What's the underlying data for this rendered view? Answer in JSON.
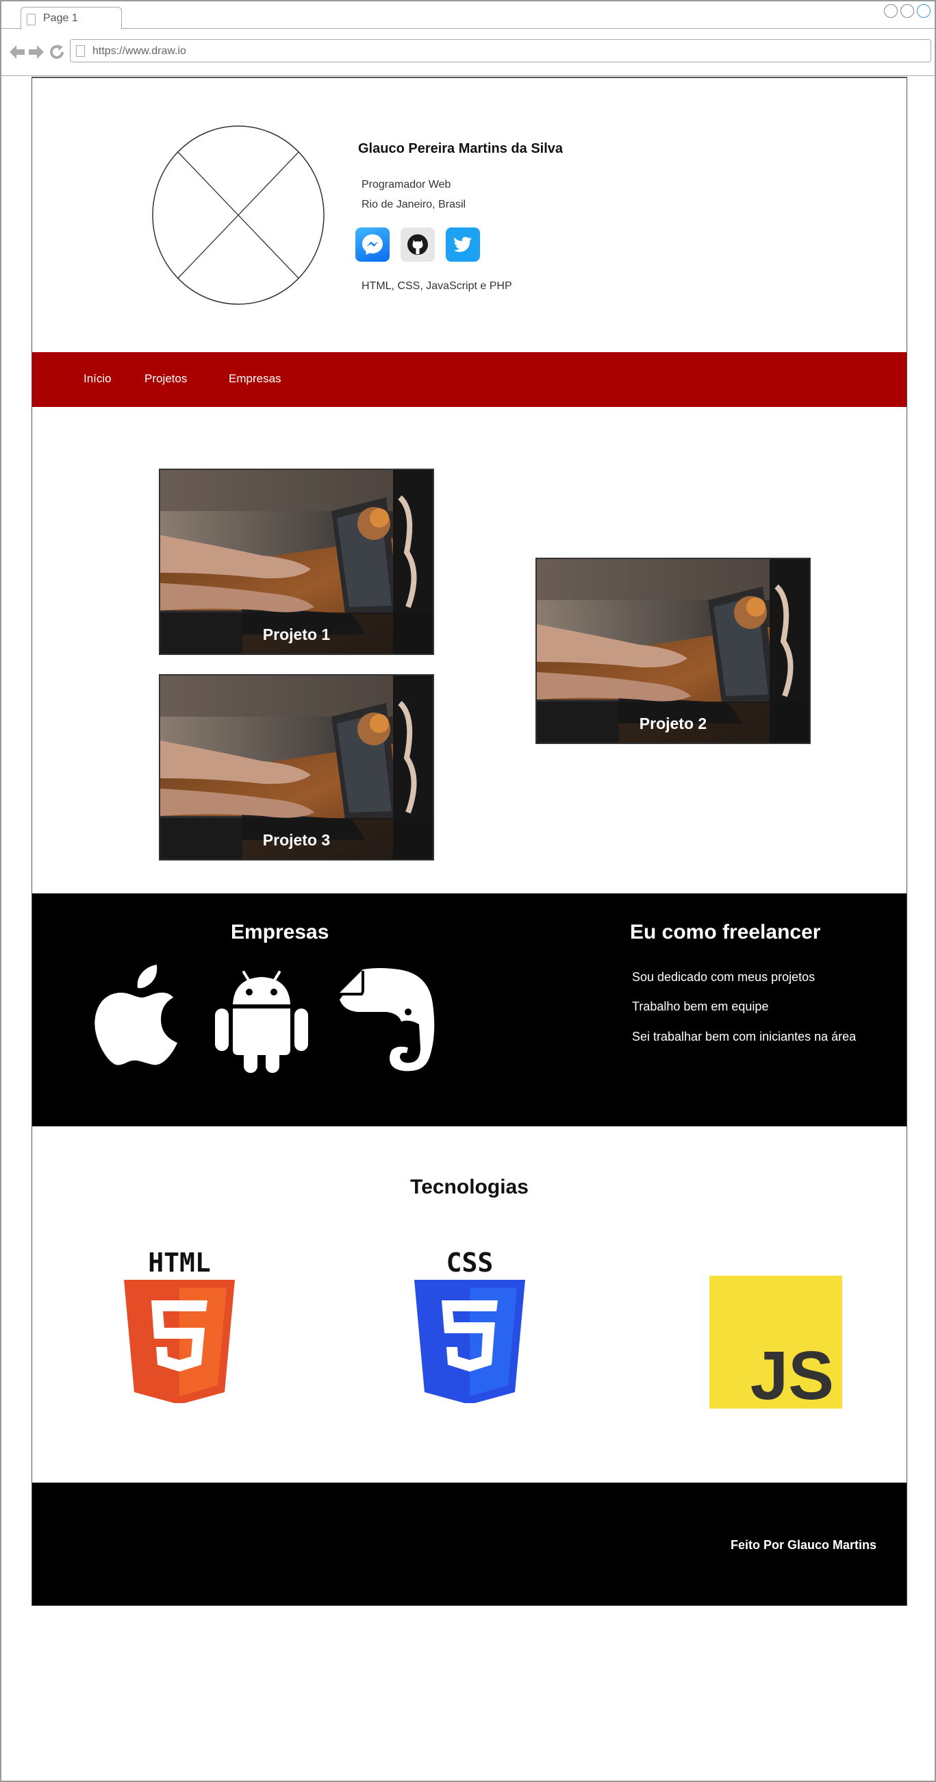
{
  "browser": {
    "tab_label": "Page 1",
    "url": "https://www.draw.io"
  },
  "profile": {
    "name": "Glauco Pereira Martins da Silva",
    "role": "Programador Web",
    "location": "Rio de Janeiro, Brasil",
    "socials": [
      "messenger-icon",
      "github-icon",
      "twitter-icon"
    ],
    "skills": "HTML, CSS, JavaScript e PHP"
  },
  "nav": {
    "items": [
      "Início",
      "Projetos",
      "Empresas"
    ],
    "color": "#a90000"
  },
  "projects": {
    "items": [
      {
        "title": "Projeto 1"
      },
      {
        "title": "Projeto 2"
      },
      {
        "title": "Projeto 3"
      }
    ]
  },
  "companies": {
    "title": "Empresas",
    "logos": [
      "apple-logo",
      "android-logo",
      "evernote-logo"
    ]
  },
  "freelancer": {
    "title": "Eu como freelancer",
    "items": [
      "Sou dedicado com meus projetos",
      "Trabalho bem em equipe",
      "Sei trabalhar bem com iniciantes na área"
    ]
  },
  "tech": {
    "title": "Tecnologias",
    "html_label": "HTML",
    "css_label": "CSS",
    "js_label": "JS"
  },
  "footer": {
    "credit": "Feito Por Glauco Martins"
  }
}
